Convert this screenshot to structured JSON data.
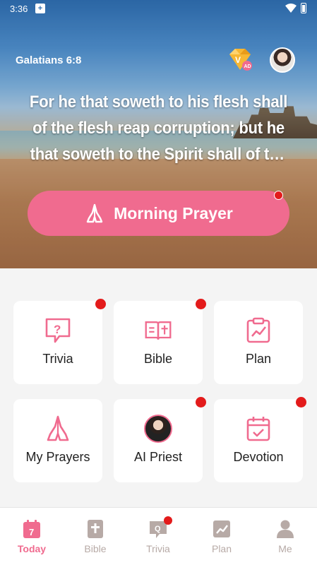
{
  "status": {
    "time": "3:36"
  },
  "header": {
    "verse_ref": "Galatians 6:8",
    "verse_text": "For he that soweth to his flesh shall of the flesh reap corruption; but he that soweth to the Spirit shall of the Spirit reap life everlasting.",
    "vip_badge_text": "AD"
  },
  "prayer_button": {
    "label": "Morning Prayer",
    "has_notification": true
  },
  "cards": [
    {
      "label": "Trivia",
      "icon": "question-book-icon",
      "has_dot": true
    },
    {
      "label": "Bible",
      "icon": "open-bible-icon",
      "has_dot": true
    },
    {
      "label": "Plan",
      "icon": "plan-chart-icon",
      "has_dot": false
    },
    {
      "label": "My Prayers",
      "icon": "praying-hands-icon",
      "has_dot": false
    },
    {
      "label": "AI Priest",
      "icon": "priest-avatar",
      "has_dot": true
    },
    {
      "label": "Devotion",
      "icon": "calendar-check-icon",
      "has_dot": true
    }
  ],
  "bottom_nav": [
    {
      "label": "Today",
      "icon": "calendar-icon",
      "badge": "7",
      "active": true
    },
    {
      "label": "Bible",
      "icon": "bible-icon",
      "active": false
    },
    {
      "label": "Trivia",
      "icon": "trivia-icon",
      "badge": "Q",
      "active": false,
      "has_dot": true
    },
    {
      "label": "Plan",
      "icon": "plan-icon",
      "active": false
    },
    {
      "label": "Me",
      "icon": "person-icon",
      "active": false
    }
  ],
  "colors": {
    "accent": "#f06b8f",
    "dot": "#e31b1b",
    "inactive": "#b7aaa6"
  }
}
